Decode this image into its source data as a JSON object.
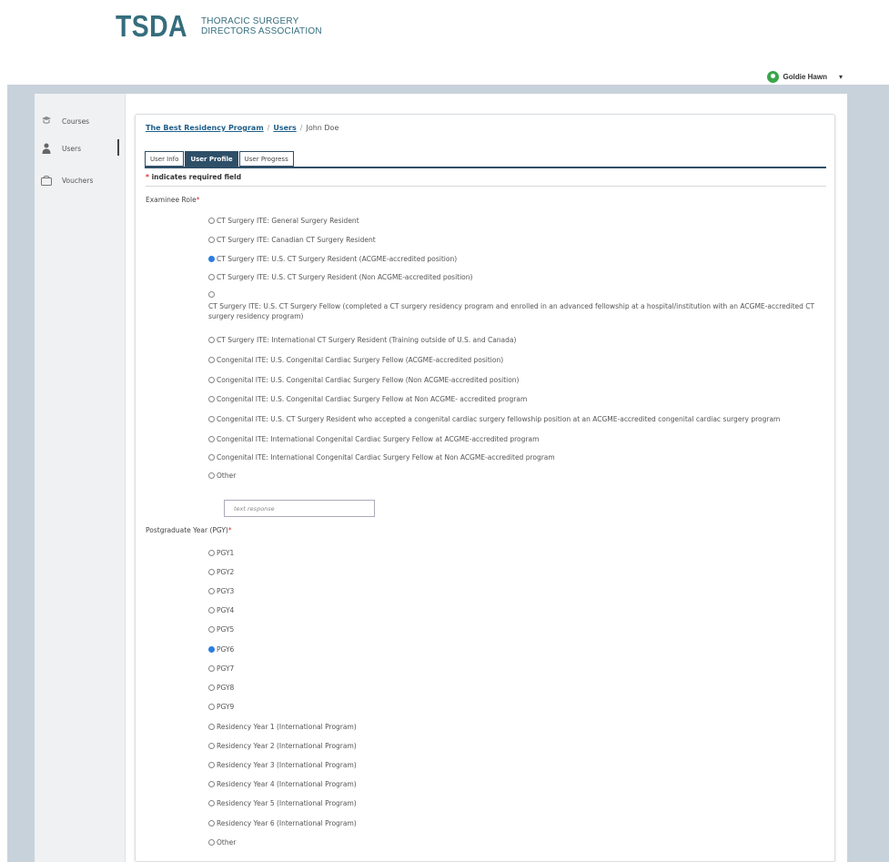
{
  "brand": {
    "mark": "TSDA",
    "line1": "THORACIC SURGERY",
    "line2": "DIRECTORS ASSOCIATION"
  },
  "user": {
    "name": "Goldie Hawn",
    "caret": "▾"
  },
  "sidebar": {
    "items": [
      {
        "label": "Courses",
        "icon": "courses-icon"
      },
      {
        "label": "Users",
        "icon": "user-icon"
      },
      {
        "label": "Vouchers",
        "icon": "vouchers-icon"
      }
    ]
  },
  "breadcrumb": {
    "program": "The Best Residency Program",
    "users": "Users",
    "current": "John Doe",
    "separator": "/"
  },
  "tabs": [
    "User Info",
    "User Profile",
    "User Progress"
  ],
  "form": {
    "required_note": "indicates required field",
    "required_star": "*",
    "role_label": "Examinee Role",
    "role_options": [
      "CT Surgery ITE: General Surgery Resident",
      "CT Surgery ITE: Canadian CT Surgery Resident",
      "CT Surgery ITE: U.S. CT Surgery Resident (ACGME-accredited position)",
      "CT Surgery ITE: U.S. CT Surgery Resident (Non ACGME-accredited position)",
      "CT Surgery ITE: U.S. CT Surgery Fellow (completed a CT surgery residency program and enrolled in an advanced fellowship at a hospital/institution with an ACGME-accredited CT surgery residency program)",
      "CT Surgery ITE: International CT Surgery Resident (Training outside of U.S. and Canada)",
      "Congenital ITE: U.S. Congenital Cardiac Surgery Fellow (ACGME-accredited position)",
      "Congenital ITE: U.S. Congenital Cardiac Surgery Fellow (Non ACGME-accredited position)",
      "Congenital ITE: U.S. Congenital Cardiac Surgery Fellow at Non ACGME- accredited program",
      "Congenital ITE: U.S. CT Surgery Resident who accepted a congenital cardiac surgery fellowship position at an ACGME-accredited congenital cardiac surgery program",
      "Congenital ITE: International Congenital Cardiac Surgery Fellow at ACGME-accredited program",
      "Congenital ITE: International Congenital Cardiac Surgery Fellow at Non ACGME-accredited program",
      "Other"
    ],
    "role_selected_index": 2,
    "text_response_placeholder": "text response",
    "pgy_label": "Postgraduate Year (PGY)",
    "pgy_options": [
      "PGY1",
      "PGY2",
      "PGY3",
      "PGY4",
      "PGY5",
      "PGY6",
      "PGY7",
      "PGY8",
      "PGY9",
      "Residency Year 1 (International Program)",
      "Residency Year 2 (International Program)",
      "Residency Year 3 (International Program)",
      "Residency Year 4 (International Program)",
      "Residency Year 5 (International Program)",
      "Residency Year 6 (International Program)",
      "Other"
    ],
    "pgy_selected_index": 5
  },
  "colors": {
    "brand": "#356d7d",
    "tab_active": "#2e4f68",
    "radio_checked": "#2b7de0",
    "frame": "#c8d2db"
  }
}
